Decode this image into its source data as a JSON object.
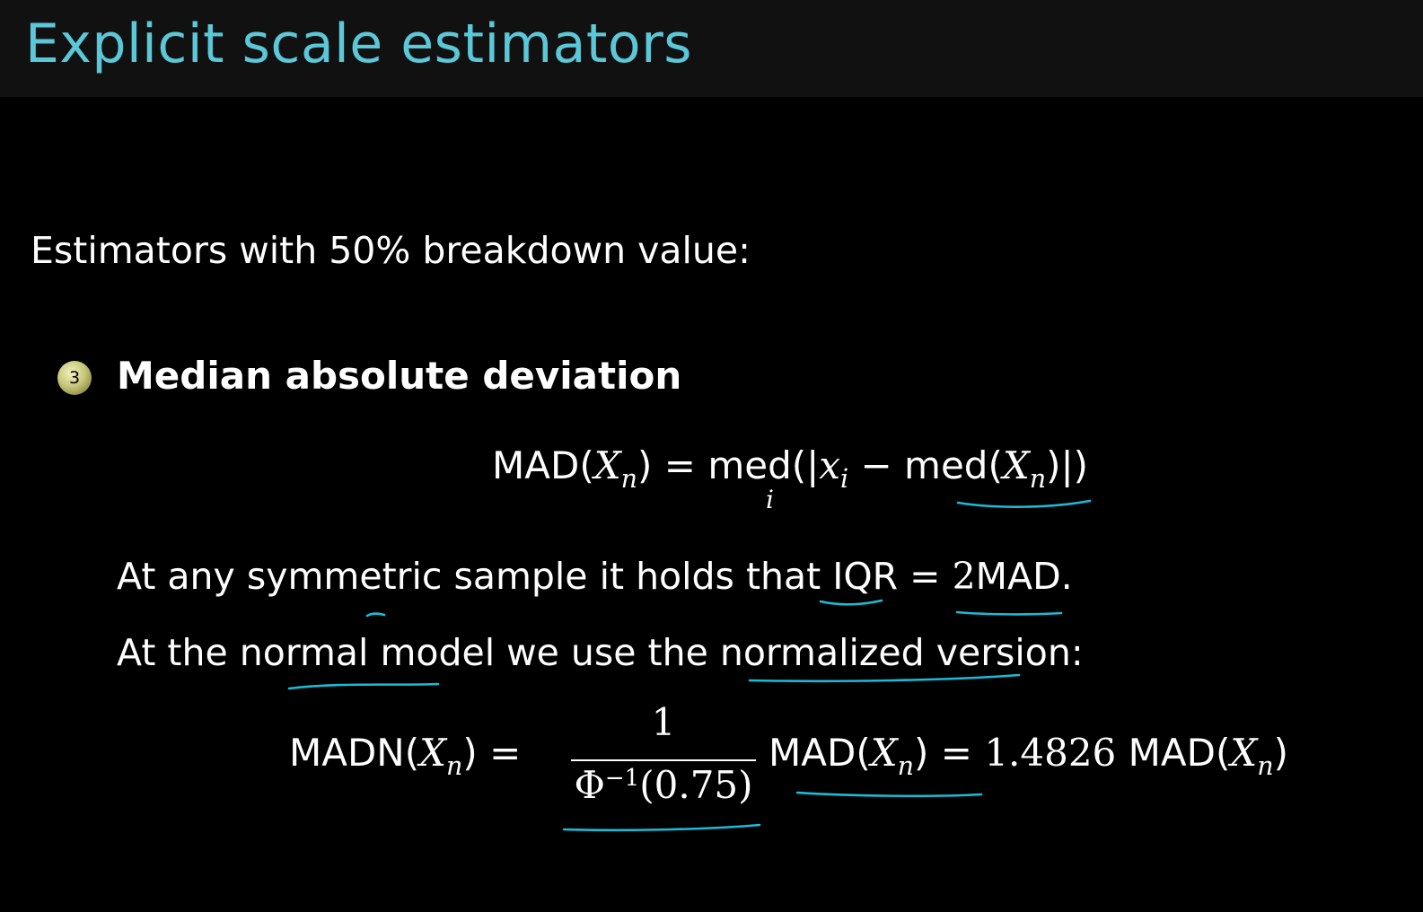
{
  "slide": {
    "title": "Explicit scale estimators",
    "intro": "Estimators with 50% breakdown value:",
    "bullet_number": "3",
    "bullet_title": "Median absolute deviation",
    "eq1": {
      "lhs_op": "MAD",
      "var": "X",
      "sub": "n",
      "eq": "=",
      "med": "med",
      "med_sub": "i",
      "x": "x",
      "x_sub": "i",
      "minus": "−",
      "inner_med": "med"
    },
    "line_a": {
      "text": "At any symmetric sample it holds that ",
      "iqr": "IQR",
      "eq": "=",
      "two": "2",
      "mad": "MAD",
      "period": "."
    },
    "line_b": "At the normal model we use the normalized version:",
    "eq2": {
      "lhs_op": "MADN",
      "var": "X",
      "sub": "n",
      "eq": "=",
      "numerator": "1",
      "phi": "Φ",
      "phi_sup": "−1",
      "arg": "(0.75)",
      "mad": "MAD",
      "const": "1.4826"
    },
    "annotation_color": "#1cbad6",
    "title_color": "#5ac8d8"
  }
}
